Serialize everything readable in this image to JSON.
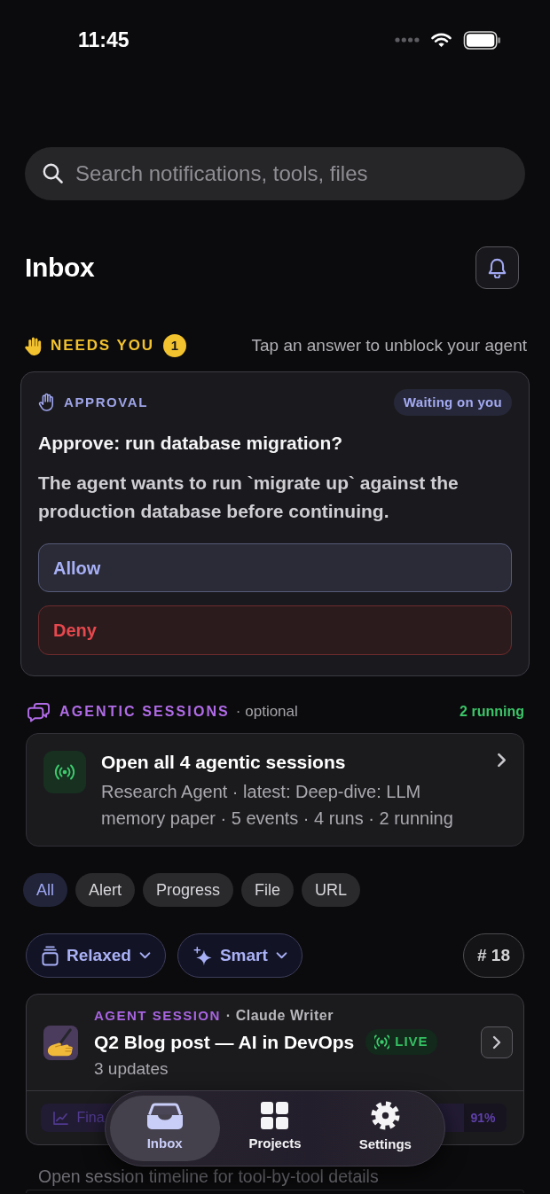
{
  "status_bar": {
    "time": "11:45"
  },
  "search": {
    "placeholder": "Search notifications, tools, files"
  },
  "header": {
    "title": "Inbox"
  },
  "needs_you": {
    "label": "NEEDS YOU",
    "count": "1",
    "hint": "Tap an answer to unblock your agent"
  },
  "approval": {
    "kind_label": "APPROVAL",
    "status": "Waiting on you",
    "title": "Approve: run database migration?",
    "body": "The agent wants to run `migrate up` against the production database before continuing.",
    "actions": [
      {
        "label": "Allow",
        "kind": "primary"
      },
      {
        "label": "Deny",
        "kind": "danger"
      }
    ]
  },
  "agentic_sessions": {
    "label": "AGENTIC SESSIONS",
    "note": "· optional",
    "running": "2 running",
    "summary": {
      "title": "Open all 4 agentic sessions",
      "detail": "Research Agent · latest: Deep-dive: LLM memory paper · 5 events · 4 runs · 2 running"
    }
  },
  "filters": [
    {
      "label": "All",
      "selected": true
    },
    {
      "label": "Alert",
      "selected": false
    },
    {
      "label": "Progress",
      "selected": false
    },
    {
      "label": "File",
      "selected": false
    },
    {
      "label": "URL",
      "selected": false
    }
  ],
  "controls": {
    "density": "Relaxed",
    "sort": "Smart",
    "count": "# 18"
  },
  "items": [
    {
      "type_label": "AGENT SESSION",
      "source": "· Claude Writer",
      "title": "Q2 Blog post — AI in DevOps",
      "live": true,
      "live_label": "LIVE",
      "subtitle": "3 updates",
      "progress": {
        "label": "Fina",
        "level": 0.91,
        "reading": "91%"
      },
      "footnote": "Open session timeline for tool-by-tool details"
    }
  ],
  "tab_bar": [
    {
      "label": "Inbox",
      "selected": true
    },
    {
      "label": "Projects",
      "selected": false
    },
    {
      "label": "Settings",
      "selected": false
    }
  ]
}
